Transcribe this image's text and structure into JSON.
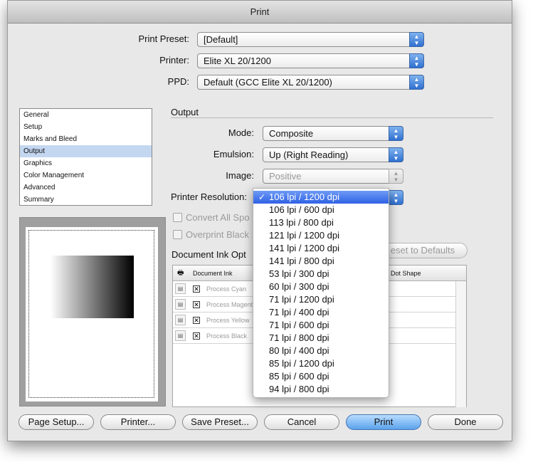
{
  "window": {
    "title": "Print"
  },
  "preset": {
    "print_preset_label": "Print Preset:",
    "print_preset_value": "[Default]",
    "printer_label": "Printer:",
    "printer_value": "Elite XL 20/1200",
    "ppd_label": "PPD:",
    "ppd_value": "Default (GCC Elite XL 20/1200)"
  },
  "sidebar": {
    "items": [
      "General",
      "Setup",
      "Marks and Bleed",
      "Output",
      "Graphics",
      "Color Management",
      "Advanced",
      "Summary"
    ],
    "selected": "Output"
  },
  "output": {
    "section_title": "Output",
    "mode_label": "Mode:",
    "mode_value": "Composite",
    "emulsion_label": "Emulsion:",
    "emulsion_value": "Up (Right Reading)",
    "image_label": "Image:",
    "image_value": "Positive",
    "printer_resolution_label": "Printer Resolution:",
    "convert_all_spot_label": "Convert All Spo",
    "overprint_black_label": "Overprint Black",
    "doc_ink_options_label": "Document Ink Opt",
    "reset_defaults_label": "eset to Defaults"
  },
  "ink_table": {
    "col_document_ink": "Document Ink",
    "col_dot_shape": "Dot Shape",
    "rows": [
      "Process Cyan",
      "Process Magent",
      "Process Yellow",
      "Process Black"
    ]
  },
  "resolution_menu": {
    "selected": "106 lpi / 1200 dpi",
    "options": [
      "106 lpi / 1200 dpi",
      "106 lpi / 600 dpi",
      "113 lpi / 800 dpi",
      "121 lpi / 1200 dpi",
      "141 lpi / 1200 dpi",
      "141 lpi / 800 dpi",
      "53 lpi / 300 dpi",
      "60 lpi / 300 dpi",
      "71 lpi / 1200 dpi",
      "71 lpi / 400 dpi",
      "71 lpi / 600 dpi",
      "71 lpi / 800 dpi",
      "80 lpi / 400 dpi",
      "85 lpi / 1200 dpi",
      "85 lpi / 600 dpi",
      "94 lpi / 800 dpi"
    ]
  },
  "buttons": {
    "page_setup": "Page Setup...",
    "printer": "Printer...",
    "save_preset": "Save Preset...",
    "cancel": "Cancel",
    "print": "Print",
    "done": "Done"
  },
  "colors": {
    "accent": "#3b6fe0",
    "selection": "#c4d7f1"
  }
}
